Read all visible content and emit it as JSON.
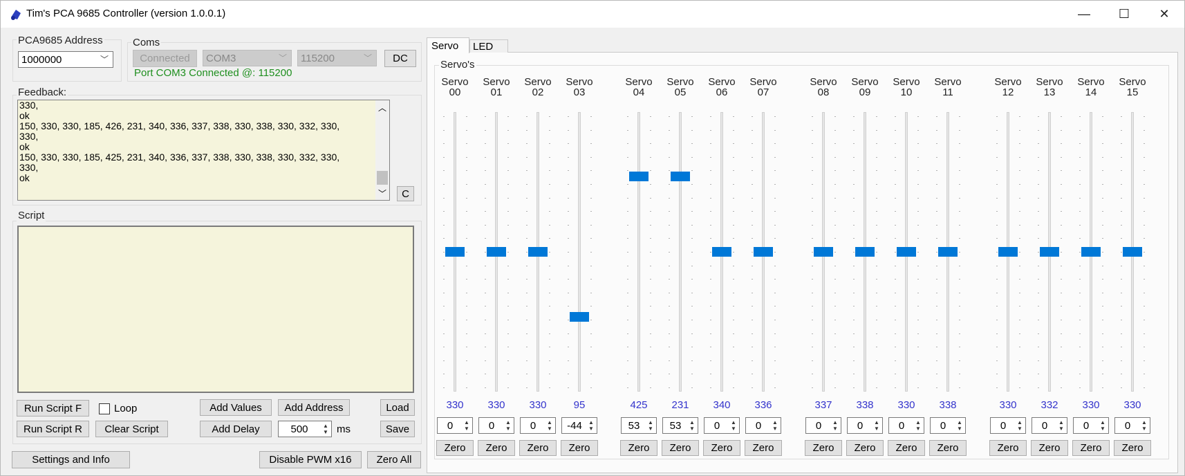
{
  "window": {
    "title": "Tim's PCA 9685 Controller (version 1.0.0.1)",
    "minimize": "—",
    "maximize": "☐",
    "close": "✕"
  },
  "address": {
    "legend": "PCA9685 Address",
    "value": "1000000"
  },
  "coms": {
    "legend": "Coms",
    "connect_label": "Connected",
    "port": "COM3",
    "baud": "115200",
    "dc_label": "DC",
    "status": "Port COM3 Connected @: 115200"
  },
  "feedback": {
    "legend": "Feedback:",
    "lines": [
      "330,",
      "ok",
      "150, 330, 330, 185, 426, 231, 340, 336, 337, 338, 330, 338, 330, 332, 330,",
      "330,",
      "ok",
      "150, 330, 330, 185, 425, 231, 340, 336, 337, 338, 330, 338, 330, 332, 330,",
      "330,",
      "ok"
    ],
    "clear_label": "C"
  },
  "script": {
    "legend": "Script",
    "run_f": "Run Script F",
    "run_r": "Run Script R",
    "loop": "Loop",
    "clear": "Clear Script",
    "add_values": "Add Values",
    "add_address": "Add Address",
    "add_delay": "Add Delay",
    "delay_value": "500",
    "delay_unit": "ms",
    "load": "Load",
    "save": "Save"
  },
  "footer": {
    "settings": "Settings and Info",
    "disable_pwm": "Disable PWM x16",
    "zero_all": "Zero All"
  },
  "tabs": {
    "servo": "Servo",
    "led": "LED"
  },
  "servos_legend": "Servo's",
  "servo_word": "Servo",
  "zero_label": "Zero",
  "servos": [
    {
      "id": "00",
      "value": "330",
      "offset": "0",
      "level": 0.5
    },
    {
      "id": "01",
      "value": "330",
      "offset": "0",
      "level": 0.5
    },
    {
      "id": "02",
      "value": "330",
      "offset": "0",
      "level": 0.5
    },
    {
      "id": "03",
      "value": "95",
      "offset": "-44",
      "level": 0.26
    },
    {
      "id": "04",
      "value": "425",
      "offset": "53",
      "level": 0.78
    },
    {
      "id": "05",
      "value": "231",
      "offset": "53",
      "level": 0.78
    },
    {
      "id": "06",
      "value": "340",
      "offset": "0",
      "level": 0.5
    },
    {
      "id": "07",
      "value": "336",
      "offset": "0",
      "level": 0.5
    },
    {
      "id": "08",
      "value": "337",
      "offset": "0",
      "level": 0.5
    },
    {
      "id": "09",
      "value": "338",
      "offset": "0",
      "level": 0.5
    },
    {
      "id": "10",
      "value": "330",
      "offset": "0",
      "level": 0.5
    },
    {
      "id": "11",
      "value": "338",
      "offset": "0",
      "level": 0.5
    },
    {
      "id": "12",
      "value": "330",
      "offset": "0",
      "level": 0.5
    },
    {
      "id": "13",
      "value": "332",
      "offset": "0",
      "level": 0.5
    },
    {
      "id": "14",
      "value": "330",
      "offset": "0",
      "level": 0.5
    },
    {
      "id": "15",
      "value": "330",
      "offset": "0",
      "level": 0.5
    }
  ]
}
